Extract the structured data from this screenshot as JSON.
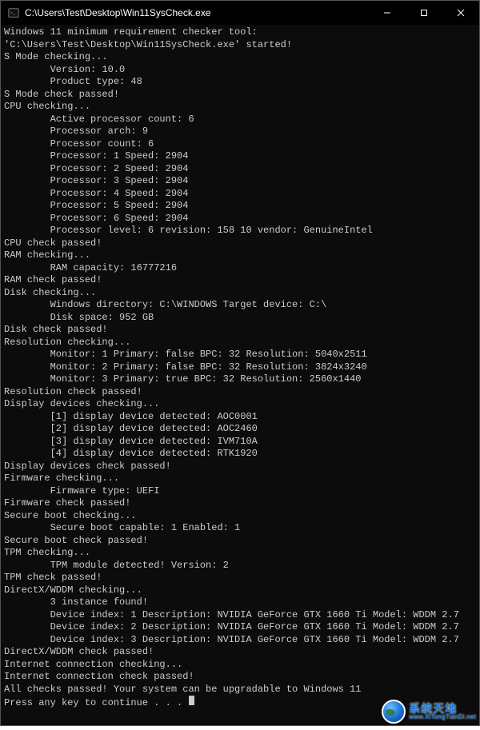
{
  "window": {
    "title": "C:\\Users\\Test\\Desktop\\Win11SysCheck.exe"
  },
  "console": {
    "lines": [
      "Windows 11 minimum requirement checker tool: 'C:\\Users\\Test\\Desktop\\Win11SysCheck.exe' started!",
      "S Mode checking...",
      "        Version: 10.0",
      "        Product type: 48",
      "S Mode check passed!",
      "CPU checking...",
      "        Active processor count: 6",
      "        Processor arch: 9",
      "        Processor count: 6",
      "        Processor: 1 Speed: 2904",
      "        Processor: 2 Speed: 2904",
      "        Processor: 3 Speed: 2904",
      "        Processor: 4 Speed: 2904",
      "        Processor: 5 Speed: 2904",
      "        Processor: 6 Speed: 2904",
      "        Processor level: 6 revision: 158 10 vendor: GenuineIntel",
      "CPU check passed!",
      "RAM checking...",
      "        RAM capacity: 16777216",
      "RAM check passed!",
      "Disk checking...",
      "        Windows directory: C:\\WINDOWS Target device: C:\\",
      "        Disk space: 952 GB",
      "Disk check passed!",
      "Resolution checking...",
      "        Monitor: 1 Primary: false BPC: 32 Resolution: 5040x2511",
      "        Monitor: 2 Primary: false BPC: 32 Resolution: 3824x3240",
      "        Monitor: 3 Primary: true BPC: 32 Resolution: 2560x1440",
      "Resolution check passed!",
      "Display devices checking...",
      "        [1] display device detected: AOC0001",
      "        [2] display device detected: AOC2460",
      "        [3] display device detected: IVM710A",
      "        [4] display device detected: RTK1920",
      "Display devices check passed!",
      "Firmware checking...",
      "        Firmware type: UEFI",
      "Firmware check passed!",
      "Secure boot checking...",
      "        Secure boot capable: 1 Enabled: 1",
      "Secure boot check passed!",
      "TPM checking...",
      "        TPM module detected! Version: 2",
      "TPM check passed!",
      "DirectX/WDDM checking...",
      "        3 instance found!",
      "        Device index: 1 Description: NVIDIA GeForce GTX 1660 Ti Model: WDDM 2.7",
      "        Device index: 2 Description: NVIDIA GeForce GTX 1660 Ti Model: WDDM 2.7",
      "        Device index: 3 Description: NVIDIA GeForce GTX 1660 Ti Model: WDDM 2.7",
      "DirectX/WDDM check passed!",
      "Internet connection checking...",
      "Internet connection check passed!",
      "All checks passed! Your system can be upgradable to Windows 11",
      "Press any key to continue . . . "
    ]
  },
  "watermark": {
    "name": "系统天地",
    "url": "www.XiTongTianDi.net"
  }
}
